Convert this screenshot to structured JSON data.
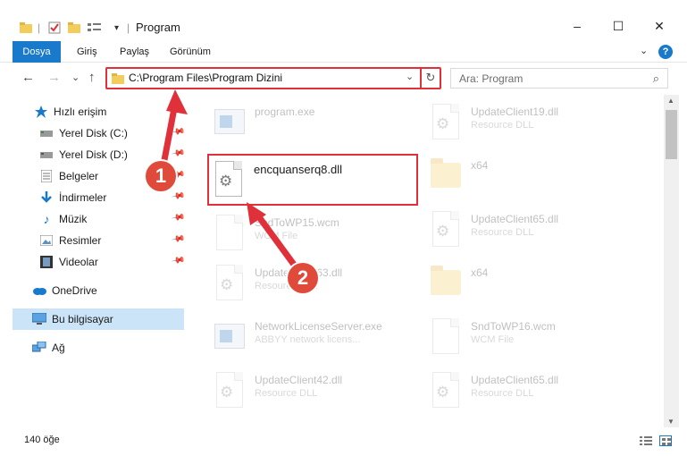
{
  "window": {
    "title": "Program",
    "minimize": "–",
    "maximize": "☐",
    "close": "✕"
  },
  "ribbon": {
    "tabs": [
      "Dosya",
      "Giriş",
      "Paylaş",
      "Görünüm"
    ],
    "active_tab": "Dosya",
    "help": "?",
    "expand": "⌄"
  },
  "address": {
    "path": "C:\\Program Files\\Program Dizini",
    "dropdown": "⌄",
    "refresh": "↻"
  },
  "search": {
    "placeholder": "Ara: Program",
    "icon": "search-icon"
  },
  "nav": {
    "back": "←",
    "forward": "→",
    "recent": "⌄",
    "up": "↑"
  },
  "sidebar": {
    "items": [
      {
        "label": "Hızlı erişim",
        "icon": "star-icon",
        "pinned": false
      },
      {
        "label": "Yerel Disk (C:)",
        "icon": "drive-icon",
        "pinned": true
      },
      {
        "label": "Yerel Disk (D:)",
        "icon": "drive-icon",
        "pinned": true
      },
      {
        "label": "Belgeler",
        "icon": "documents-icon",
        "pinned": true
      },
      {
        "label": "İndirmeler",
        "icon": "download-icon",
        "pinned": true
      },
      {
        "label": "Müzik",
        "icon": "music-icon",
        "pinned": true
      },
      {
        "label": "Resimler",
        "icon": "pictures-icon",
        "pinned": true
      },
      {
        "label": "Videolar",
        "icon": "video-icon",
        "pinned": true
      },
      {
        "label": "OneDrive",
        "icon": "cloud-icon",
        "pinned": false
      },
      {
        "label": "Bu bilgisayar",
        "icon": "computer-icon",
        "pinned": false,
        "selected": true
      },
      {
        "label": "Ağ",
        "icon": "network-icon",
        "pinned": false
      }
    ]
  },
  "files": {
    "left": [
      {
        "name": "program.exe",
        "desc": "",
        "type": "exe"
      },
      {
        "name": "encquanserq8.dll",
        "desc": "",
        "type": "dll",
        "highlighted": true
      },
      {
        "name": "SndToWP15.wcm",
        "desc": "WCM File",
        "type": "doc"
      },
      {
        "name": "UpdateClient63.dll",
        "desc": "Resource DLL",
        "type": "dll"
      },
      {
        "name": "NetworkLicenseServer.exe",
        "desc": "ABBYY network licens...",
        "type": "exe"
      },
      {
        "name": "UpdateClient42.dll",
        "desc": "Resource DLL",
        "type": "dll"
      }
    ],
    "right": [
      {
        "name": "UpdateClient19.dll",
        "desc": "Resource DLL",
        "type": "dll"
      },
      {
        "name": "x64",
        "desc": "",
        "type": "folder"
      },
      {
        "name": "UpdateClient65.dll",
        "desc": "Resource DLL",
        "type": "dll"
      },
      {
        "name": "x64",
        "desc": "",
        "type": "folder"
      },
      {
        "name": "SndToWP16.wcm",
        "desc": "WCM File",
        "type": "doc"
      },
      {
        "name": "UpdateClient65.dll",
        "desc": "Resource DLL",
        "type": "dll"
      }
    ]
  },
  "status": {
    "count": "140 öğe"
  },
  "annotations": {
    "step1": "1",
    "step2": "2",
    "color": "#e0303a"
  }
}
